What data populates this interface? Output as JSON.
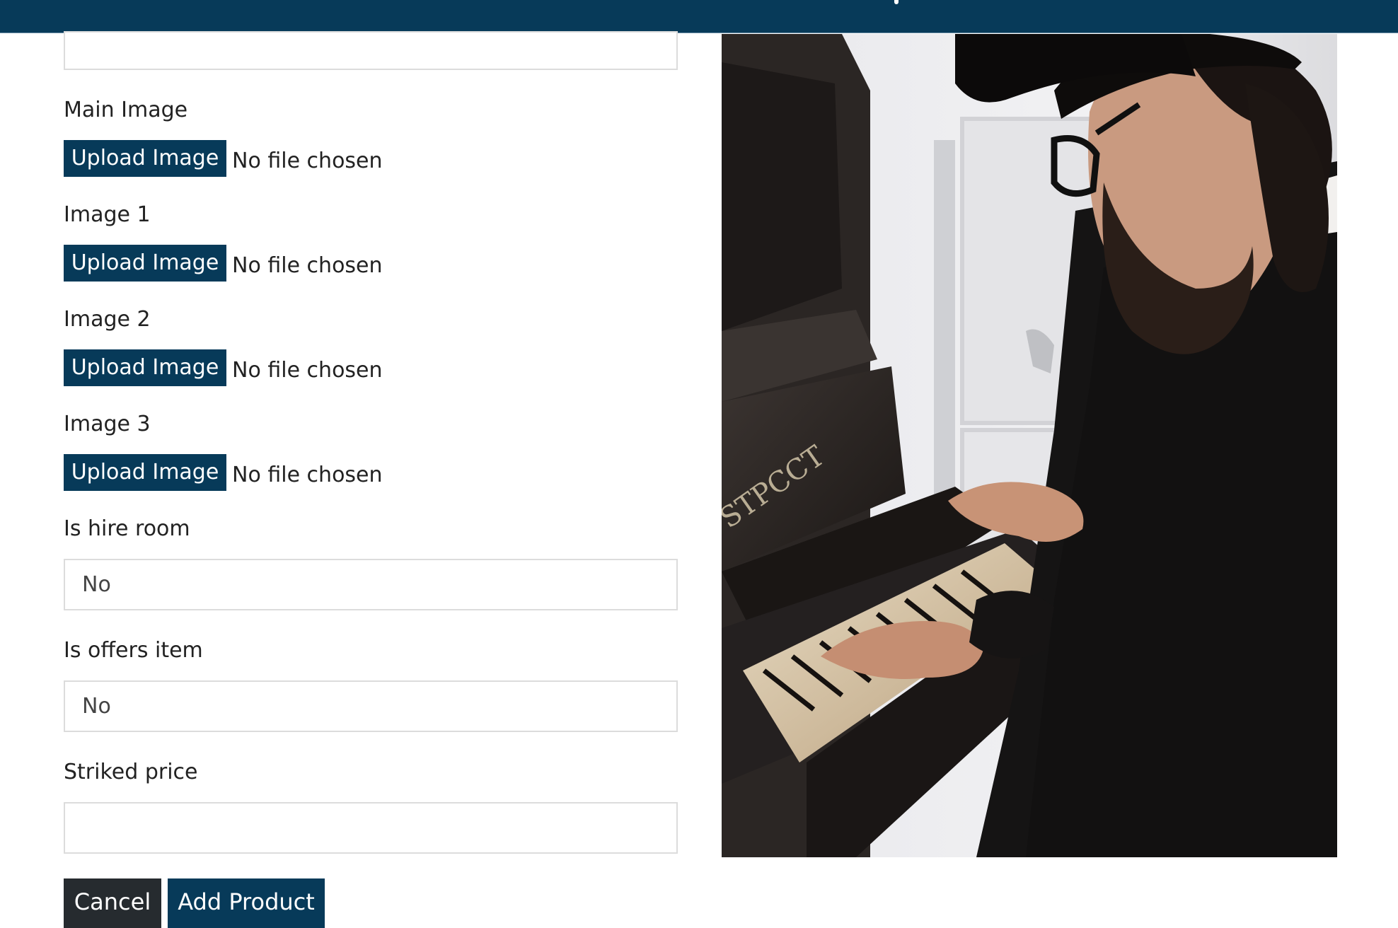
{
  "header": {
    "bar_color": "#073a59"
  },
  "form": {
    "fields": {
      "main_image": {
        "label": "Main Image",
        "button_label": "Upload Image",
        "status": "No file chosen"
      },
      "image_1": {
        "label": "Image 1",
        "button_label": "Upload Image",
        "status": "No file chosen"
      },
      "image_2": {
        "label": "Image 2",
        "button_label": "Upload Image",
        "status": "No file chosen"
      },
      "image_3": {
        "label": "Image 3",
        "button_label": "Upload Image",
        "status": "No file chosen"
      },
      "is_hire_room": {
        "label": "Is hire room",
        "value": "No"
      },
      "is_offers_item": {
        "label": "Is offers item",
        "value": "No"
      },
      "striked_price": {
        "label": "Striked price",
        "value": ""
      }
    },
    "actions": {
      "cancel_label": "Cancel",
      "add_label": "Add Product"
    }
  },
  "preview": {
    "image_subject": "pianist-photo-icon"
  },
  "colors": {
    "primary": "#073a59",
    "cancel": "#262b2f",
    "input_border": "#dcdcdc"
  }
}
